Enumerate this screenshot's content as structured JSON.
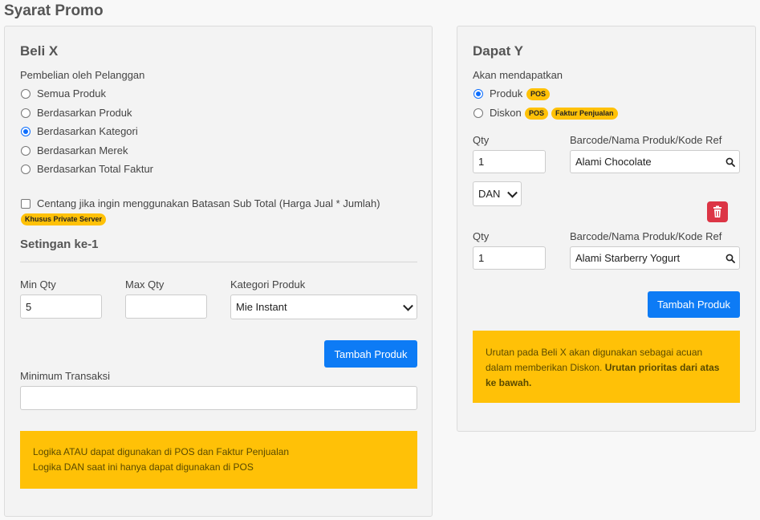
{
  "page": {
    "title": "Syarat Promo"
  },
  "beli_x": {
    "title": "Beli X",
    "purchase_label": "Pembelian oleh Pelanggan",
    "options": [
      {
        "label": "Semua Produk",
        "checked": false
      },
      {
        "label": "Berdasarkan Produk",
        "checked": false
      },
      {
        "label": "Berdasarkan Kategori",
        "checked": true
      },
      {
        "label": "Berdasarkan Merek",
        "checked": false
      },
      {
        "label": "Berdasarkan Total Faktur",
        "checked": false
      }
    ],
    "subtotal_checkbox_label": "Centang jika ingin menggunakan Batasan Sub Total (Harga Jual * Jumlah)",
    "private_server_badge": "Khusus Private Server",
    "setting_title": "Setingan ke-1",
    "min_qty_label": "Min Qty",
    "min_qty_value": "5",
    "max_qty_label": "Max Qty",
    "max_qty_value": "",
    "category_label": "Kategori Produk",
    "category_value": "Mie Instant",
    "add_product_label": "Tambah Produk",
    "min_transaction_label": "Minimum Transaksi",
    "min_transaction_value": "",
    "alert_line1": "Logika ATAU dapat digunakan di POS dan Faktur Penjualan",
    "alert_line2": "Logika DAN saat ini hanya dapat digunakan di POS"
  },
  "dapat_y": {
    "title": "Dapat Y",
    "receive_label": "Akan mendapatkan",
    "option_product": "Produk",
    "option_discount": "Diskon",
    "badge_pos": "POS",
    "badge_invoice": "Faktur Penjualan",
    "qty_label": "Qty",
    "barcode_label": "Barcode/Nama Produk/Kode Ref",
    "rows": [
      {
        "qty": "1",
        "product": "Alami Chocolate"
      },
      {
        "qty": "1",
        "product": "Alami Starberry Yogurt"
      }
    ],
    "logic_value": "DAN",
    "add_product_label": "Tambah Produk",
    "alert_text": "Urutan pada Beli X akan digunakan sebagai acuan dalam memberikan Diskon. ",
    "alert_bold": "Urutan prioritas dari atas ke bawah."
  },
  "icons": {
    "search": "search-icon",
    "delete": "trash-icon"
  },
  "colors": {
    "primary": "#0d7bf5",
    "warning": "#ffc107",
    "danger": "#dc3545"
  }
}
